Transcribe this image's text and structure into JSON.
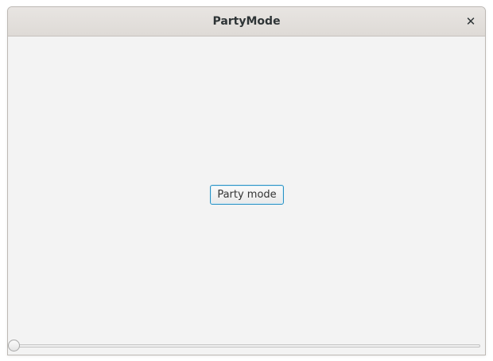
{
  "window": {
    "title": "PartyMode",
    "close_glyph": "✕",
    "close_icon": "close-icon"
  },
  "main": {
    "party_button_label": "Party mode"
  },
  "slider": {
    "value_fraction": 0.0
  },
  "colors": {
    "focus_accent": "#2a91c4",
    "background": "#f3f3f3"
  }
}
